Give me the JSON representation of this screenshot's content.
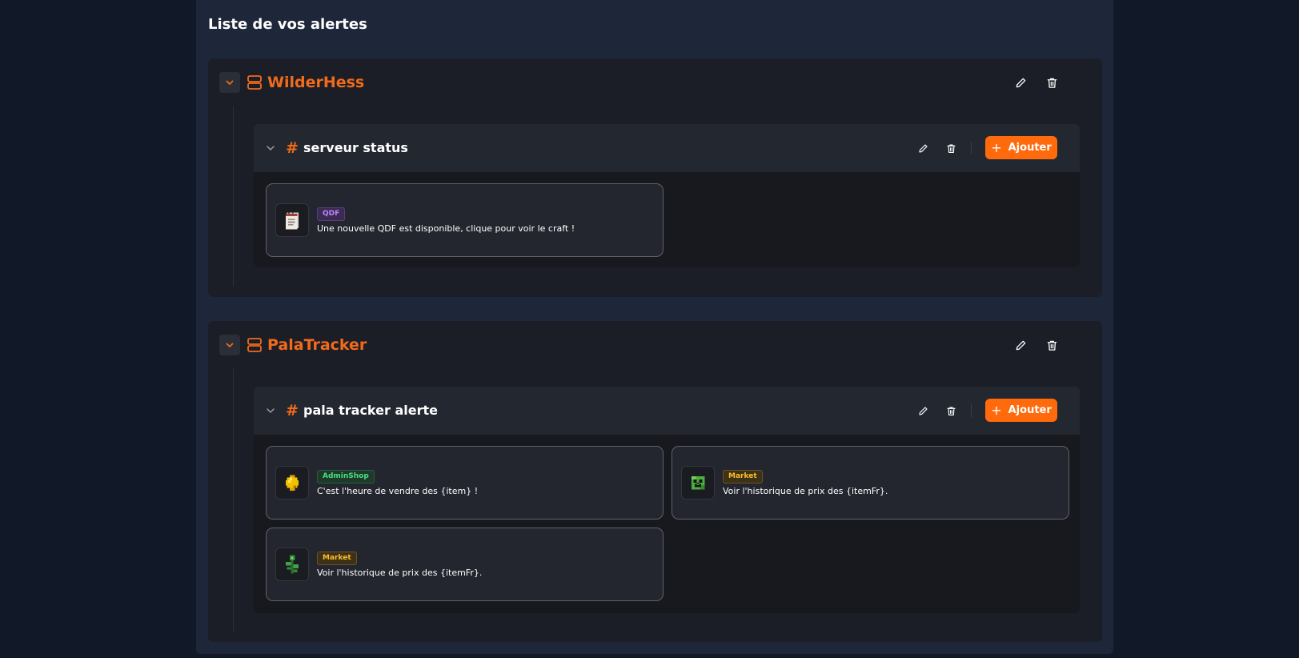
{
  "page": {
    "title": "Liste de vos alertes"
  },
  "servers": [
    {
      "name": "WilderHess",
      "channels": [
        {
          "name": "serveur status",
          "add_label": "Ajouter",
          "alerts": [
            {
              "badge": "QDF",
              "text": "Une nouvelle QDF est disponible, clique pour voir le craft !",
              "icon": "notepad-icon"
            }
          ]
        }
      ]
    },
    {
      "name": "PalaTracker",
      "channels": [
        {
          "name": "pala tracker alerte",
          "add_label": "Ajouter",
          "alerts": [
            {
              "badge": "AdminShop",
              "text": "C'est l'heure de vendre des {item} !",
              "icon": "gold-nugget-icon"
            },
            {
              "badge": "Market",
              "text": "Voir l'historique de prix des {itemFr}.",
              "icon": "creeper-head-icon"
            },
            {
              "badge": "Market",
              "text": "Voir l'historique de prix des {itemFr}.",
              "icon": "green-plant-icon"
            }
          ]
        }
      ]
    }
  ],
  "colors": {
    "accent": "#ff6a0c",
    "server_name": "#f26a1b",
    "background": "#111827",
    "panel": "#1e2739"
  }
}
